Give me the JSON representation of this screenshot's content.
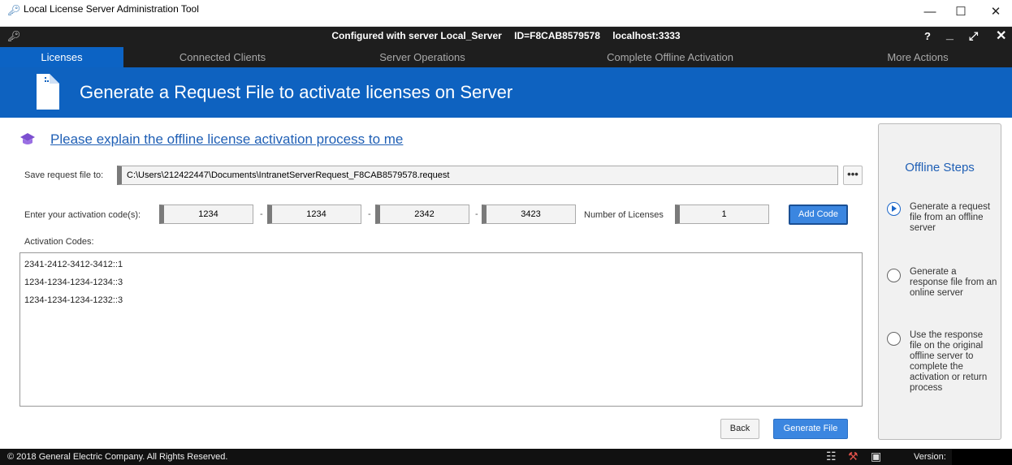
{
  "window": {
    "title": "Local License Server Administration Tool",
    "controls": {
      "minimize": "—",
      "maximize": "☐",
      "close": "✕"
    }
  },
  "server_bar": {
    "configured": "Configured with server Local_Server",
    "id": "ID=F8CAB8579578",
    "host": "localhost:3333",
    "help_icon": "help-icon",
    "minimize_icon": "minimize-icon",
    "expand_icon": "expand-icon",
    "close_icon": "close-icon"
  },
  "tabs": [
    {
      "label": "Licenses",
      "active": true
    },
    {
      "label": "Connected Clients",
      "active": false
    },
    {
      "label": "Server Operations",
      "active": false
    },
    {
      "label": "Complete Offline Activation",
      "active": false
    },
    {
      "label": "More Actions",
      "active": false
    }
  ],
  "banner": {
    "title": "Generate a Request File to activate licenses on Server"
  },
  "explain_link": "Please explain the offline license activation process to me",
  "save": {
    "label": "Save request file to:",
    "path": "C:\\Users\\212422447\\Documents\\IntranetServerRequest_F8CAB8579578.request",
    "browse": "•••"
  },
  "activation": {
    "label": "Enter your activation code(s):",
    "codes": [
      "1234",
      "1234",
      "2342",
      "3423"
    ],
    "separator": "-",
    "num_licenses_label": "Number of Licenses",
    "num_licenses": "1",
    "add_button": "Add Code"
  },
  "codes_list": {
    "label": "Activation Codes:",
    "items": [
      "2341-2412-3412-3412::1",
      "1234-1234-1234-1234::3",
      "1234-1234-1234-1232::3"
    ]
  },
  "buttons": {
    "back": "Back",
    "generate": "Generate File"
  },
  "steps": {
    "title": "Offline Steps",
    "items": [
      {
        "text": "Generate a request file from an offline server",
        "active": true
      },
      {
        "text": "Generate a response file from an online server",
        "active": false
      },
      {
        "text": "Use the response file on the original offline server to complete the activation or return process",
        "active": false
      }
    ]
  },
  "status": {
    "copyright": "© 2018 General Electric Company. All Rights Reserved.",
    "version_label": "Version:",
    "icons": [
      "database-icon",
      "tools-icon",
      "user-monitor-icon"
    ]
  },
  "colors": {
    "accent": "#0c63c4",
    "banner": "#0e62c0",
    "dark_bar": "#1e1e1e",
    "link": "#1f5fb5"
  }
}
